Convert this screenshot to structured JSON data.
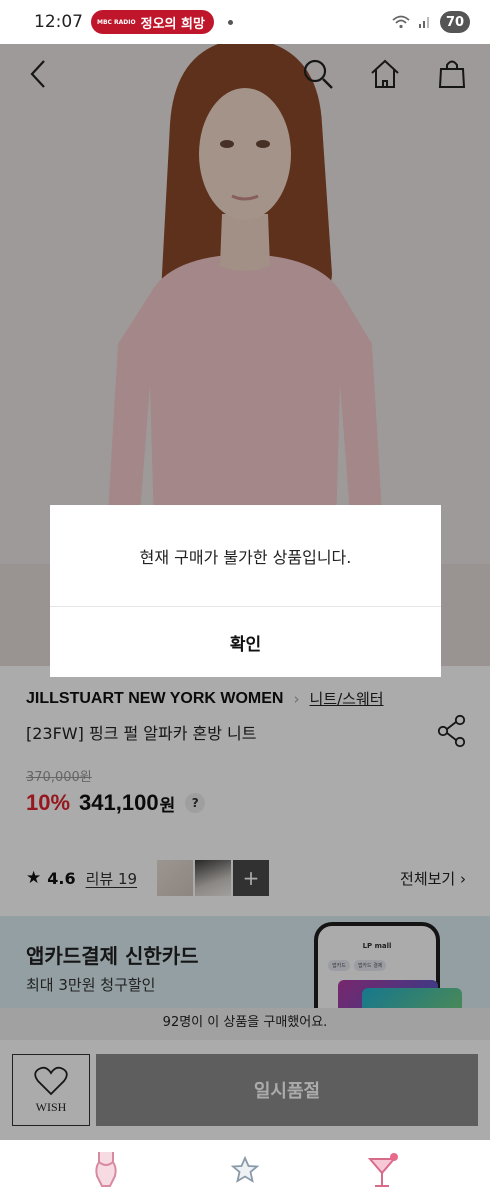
{
  "status_bar": {
    "time": "12:07",
    "notification_logo": "MBC RADIO",
    "notification_text": "정오의 희망",
    "battery": "70",
    "icons": [
      "wifi-icon",
      "signal-icon",
      "battery-icon"
    ]
  },
  "top_nav": {
    "icons": [
      "back-arrow-icon",
      "search-icon",
      "home-icon",
      "shopping-bag-icon"
    ]
  },
  "product": {
    "brand": "JILLSTUART NEW YORK WOMEN",
    "category": "니트/스웨터",
    "title": "[23FW] 핑크 펄 알파카 혼방 니트",
    "original_price": "370,000원",
    "discount": "10%",
    "sale_price": "341,100",
    "currency": "원",
    "help": "?",
    "rating": "4.6",
    "review_link": "리뷰 19",
    "see_all": "전체보기 ›",
    "thumb_more": "+"
  },
  "banner": {
    "title": "앱카드결제 신한카드",
    "subtitle": "최대 3만원 청구할인",
    "phone_brand": "LP mall",
    "phone_tabs": [
      "앱카드",
      "앱카드 결제"
    ]
  },
  "buyers_note": "92명이 이 상품을 구매했어요.",
  "action_bar": {
    "wish_label": "WISH",
    "buy_button": "일시품절"
  },
  "bottom_nav": {
    "icons": [
      "bodysuit-icon",
      "star-icon",
      "cocktail-icon"
    ]
  },
  "dialog": {
    "message": "현재 구매가 불가한 상품입니다.",
    "confirm": "확인"
  },
  "colors": {
    "discount_red": "#e0242f",
    "soldout_gray": "#8d8d8d",
    "banner_bg": "#dbeef3",
    "notification_red": "#c0162b"
  }
}
